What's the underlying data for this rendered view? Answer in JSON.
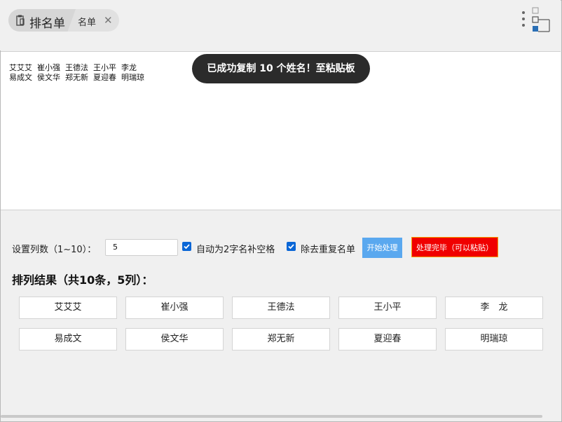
{
  "app": {
    "label": "排名单",
    "icon": "clipboard-icon"
  },
  "tab": {
    "label": "名单",
    "close_icon": "close-icon"
  },
  "toolbar": {
    "more_icon": "more-vertical-icon",
    "layout_icon": "layout-icon"
  },
  "editor": {
    "lines": [
      "艾艾艾  崔小强  王德法  王小平  李龙",
      "易成文  侯文华  郑无新  夏迎春  明瑞琼"
    ]
  },
  "toast": "已成功复制 10 个姓名！至粘贴板",
  "controls": {
    "columns_label": "设置列数（1~10）：",
    "columns_value": "5",
    "pad_label": "自动为2字名补空格",
    "pad_checked": true,
    "dedupe_label": "除去重复名单",
    "dedupe_checked": true,
    "start_button": "开始处理",
    "done_button": "处理完毕（可以粘贴）"
  },
  "result": {
    "title": "排列结果（共10条，5列）：",
    "rows": [
      [
        "艾艾艾",
        "崔小强",
        "王德法",
        "王小平",
        "李　龙"
      ],
      [
        "易成文",
        "侯文华",
        "郑无新",
        "夏迎春",
        "明瑞琼"
      ]
    ]
  },
  "colors": {
    "accent": "#0a66d6",
    "start_button": "#5aa8ef",
    "done_button": "#f00000",
    "toast_bg": "#2b2b2b"
  }
}
